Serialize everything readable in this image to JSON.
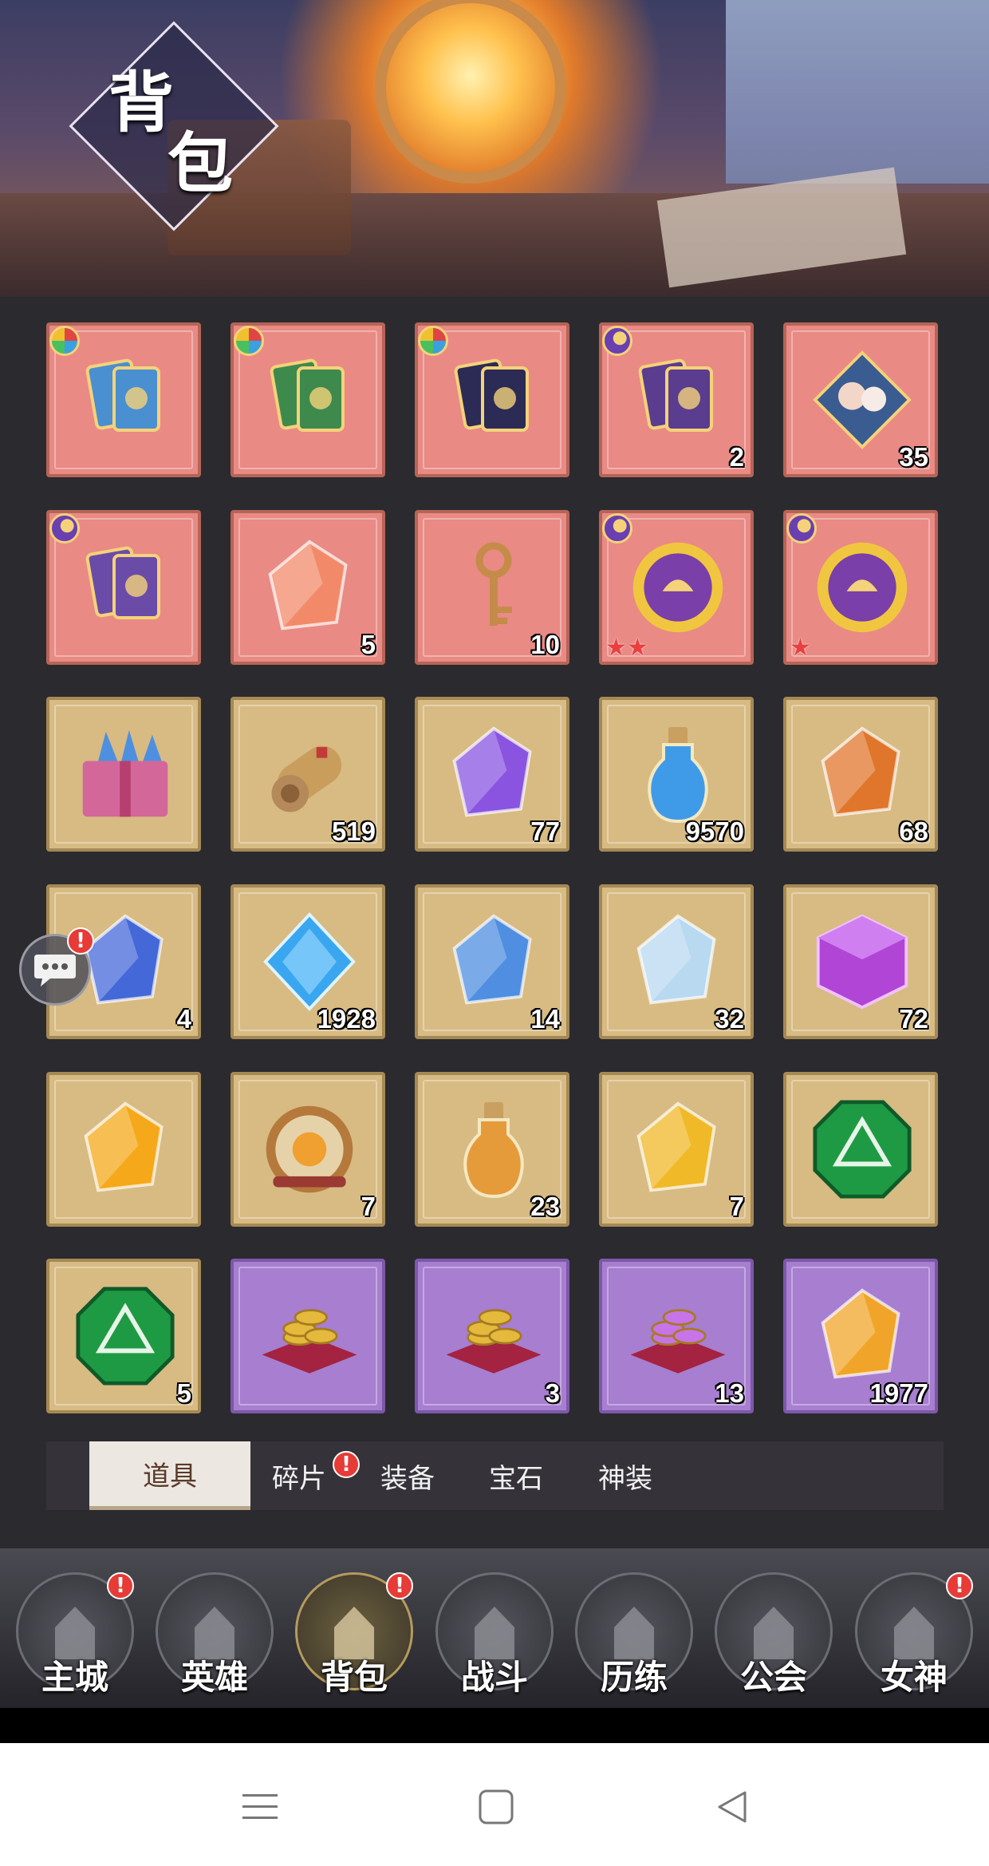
{
  "header": {
    "title_char1": "背",
    "title_char2": "包"
  },
  "items": [
    {
      "count": "",
      "badge": "multi",
      "bg": "red",
      "color": "#4a8fd0"
    },
    {
      "count": "",
      "badge": "multi",
      "bg": "red",
      "color": "#3e8a4d"
    },
    {
      "count": "",
      "badge": "multi",
      "bg": "red",
      "color": "#2b2b55"
    },
    {
      "count": "2",
      "badge": "moon",
      "bg": "red",
      "color": "#5a3d8f"
    },
    {
      "count": "35",
      "badge": "",
      "bg": "red",
      "color": "#3a5c90"
    },
    {
      "count": "",
      "badge": "moon",
      "bg": "red",
      "color": "#6b4ba8"
    },
    {
      "count": "5",
      "badge": "",
      "bg": "red",
      "color": "#f28a6a"
    },
    {
      "count": "10",
      "badge": "",
      "bg": "red",
      "color": "#c58b48"
    },
    {
      "count": "",
      "badge": "moon",
      "bg": "red",
      "color": "#7a3fa8",
      "stars": "★★"
    },
    {
      "count": "",
      "badge": "moon",
      "bg": "red",
      "color": "#7a3fa8",
      "stars": "★"
    },
    {
      "count": "",
      "badge": "",
      "bg": "gold",
      "color": "#d4679a"
    },
    {
      "count": "519",
      "badge": "",
      "bg": "gold",
      "color": "#c99d5b"
    },
    {
      "count": "77",
      "badge": "",
      "bg": "gold",
      "color": "#8a54e0"
    },
    {
      "count": "9570",
      "badge": "",
      "bg": "gold",
      "color": "#3f9be8"
    },
    {
      "count": "68",
      "badge": "",
      "bg": "gold",
      "color": "#e0762b"
    },
    {
      "count": "4",
      "badge": "",
      "bg": "gold",
      "color": "#4468d8"
    },
    {
      "count": "1928",
      "badge": "",
      "bg": "gold",
      "color": "#3aa6f0"
    },
    {
      "count": "14",
      "badge": "",
      "bg": "gold",
      "color": "#4f8ee0"
    },
    {
      "count": "32",
      "badge": "",
      "bg": "gold",
      "color": "#b8d9f0"
    },
    {
      "count": "72",
      "badge": "",
      "bg": "gold",
      "color": "#b145d6"
    },
    {
      "count": "",
      "badge": "",
      "bg": "gold",
      "color": "#f5a81a"
    },
    {
      "count": "7",
      "badge": "",
      "bg": "gold",
      "color": "#b5793c"
    },
    {
      "count": "23",
      "badge": "",
      "bg": "gold",
      "color": "#e69b3a"
    },
    {
      "count": "7",
      "badge": "",
      "bg": "gold",
      "color": "#f0b928"
    },
    {
      "count": "",
      "badge": "",
      "bg": "gold",
      "color": "#1f9a44"
    },
    {
      "count": "5",
      "badge": "",
      "bg": "gold",
      "color": "#1f9a44"
    },
    {
      "count": "",
      "badge": "",
      "bg": "purple",
      "color": "#e4b93c"
    },
    {
      "count": "3",
      "badge": "",
      "bg": "purple",
      "color": "#e4b93c"
    },
    {
      "count": "13",
      "badge": "",
      "bg": "purple",
      "color": "#c774e8"
    },
    {
      "count": "1977",
      "badge": "",
      "bg": "purple",
      "color": "#f0a52a"
    }
  ],
  "tabs": [
    {
      "label": "道具",
      "active": true
    },
    {
      "label": "碎片",
      "active": false,
      "alert": "!"
    },
    {
      "label": "装备",
      "active": false
    },
    {
      "label": "宝石",
      "active": false
    },
    {
      "label": "神装",
      "active": false
    }
  ],
  "chat": {
    "alert": "!"
  },
  "nav": [
    {
      "label": "主城",
      "alert": "!"
    },
    {
      "label": "英雄",
      "alert": ""
    },
    {
      "label": "背包",
      "alert": "!",
      "active": true
    },
    {
      "label": "战斗",
      "alert": ""
    },
    {
      "label": "历练",
      "alert": ""
    },
    {
      "label": "公会",
      "alert": ""
    },
    {
      "label": "女神",
      "alert": "!"
    }
  ],
  "system_nav": [
    "menu-icon",
    "home-icon",
    "back-icon"
  ]
}
